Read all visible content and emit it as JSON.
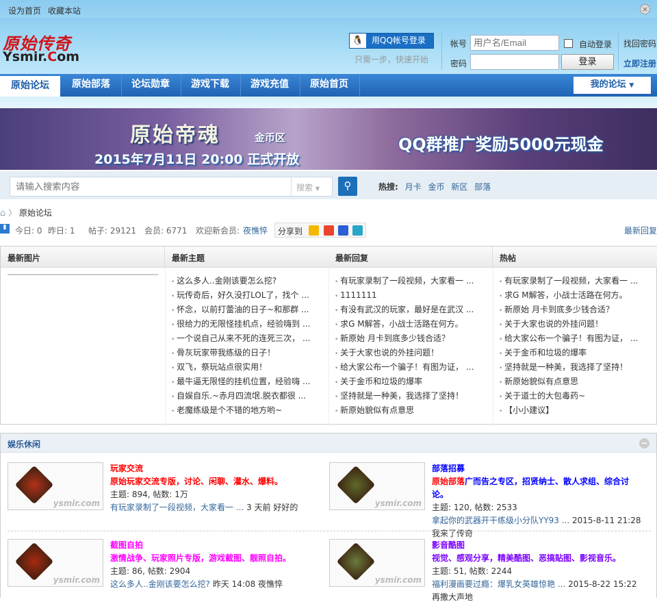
{
  "topbar": {
    "set_home": "设为首页",
    "bookmark": "收藏本站"
  },
  "logo": {
    "cn": "原始传奇",
    "en_a": "Ysmir.",
    "en_b": "C",
    "en_c": "om"
  },
  "login": {
    "qq_button": "用QQ帐号登录",
    "qq_sub": "只需一步，快速开始",
    "account_label": "帐号",
    "account_placeholder": "用户名/Email",
    "password_label": "密码",
    "auto_login": "自动登录",
    "login_button": "登录",
    "find_password": "找回密码",
    "register": "立即注册"
  },
  "nav": {
    "items": [
      "原始论坛",
      "原始部落",
      "论坛勋章",
      "游戏下载",
      "游戏充值",
      "原始首页"
    ],
    "my_forum": "我的论坛"
  },
  "banner": {
    "title": "原始帝魂",
    "zone": "金币区",
    "date": "2015年7月11日 20:00 正式开放",
    "promo": "QQ群推广奖励5000元现金"
  },
  "search": {
    "placeholder": "请输入搜索内容",
    "type": "搜索",
    "hot_label": "热搜:",
    "hot": [
      "月卡",
      "金币",
      "新区",
      "部落"
    ]
  },
  "breadcrumb": {
    "current": "原始论坛"
  },
  "stats": {
    "today": "今日: 0",
    "yesterday": "昨日: 1",
    "posts": "帖子: 29121",
    "members": "会员: 6771",
    "welcome": "欢迎新会员:",
    "new_member": "夜憔悴",
    "share": "分享到",
    "latest_reply": "最新回复"
  },
  "table": {
    "headers": [
      "最新图片",
      "最新主题",
      "最新回复",
      "热帖"
    ],
    "new_topics": [
      "这么多人..金刚该要怎么挖?",
      "玩传奇后，好久没打LOL了，找个 ...",
      "怀念，以前打蕾油的日子~和那群 ...",
      "很给力的无限怪挂机点，经验嗨到 ...",
      "一个说自己从来不死的连死三次， ...",
      "骨灰玩家带我练级的日子！",
      "双飞，祭玩站点很实用！",
      "最牛逼无限怪的挂机位置，经验嗨 ...",
      "自娱自乐.~赤月四流氓.脱衣都很 ...",
      "老魔练级是个不错的地方哟~"
    ],
    "new_replies": [
      "有玩家录制了一段视频，大家看一 ...",
      "1111111",
      "有没有武汉的玩家，最好是在武汉 ...",
      "求G M解答，小战士活路在何方。",
      "新原始 月卡到底多少钱合适？",
      "关于大家也说的外挂问题！",
      "给大家公布一个骗子！有图为证， ...",
      "关于金币和垃圾的爆率",
      "坚持就是一种美，我选择了坚持！",
      "新原始貌似有点意思"
    ],
    "hot": [
      "有玩家录制了一段视频，大家看一 ...",
      "求G M解答，小战士活路在何方。",
      "新原始 月卡到底多少钱合适？",
      "关于大家也说的外挂问题！",
      "给大家公布一个骗子！有图为证， ...",
      "关于金币和垃圾的爆率",
      "坚持就是一种美，我选择了坚持！",
      "新原始貌似有点意思",
      "关于道士的大包毒药~",
      "【小小建议】"
    ]
  },
  "section": {
    "title": "娱乐休闲",
    "watermark": "ysmir.com",
    "forums": [
      {
        "name": "玩家交流",
        "color": "#ff0000",
        "desc": "原始玩家交流专版，讨论、闲聊、灌水、爆料。",
        "desc_prefix": "",
        "counts": "主题: 894, 帖数: 1万",
        "last_link": "有玩家录制了一段视频，大家看一 ...",
        "last_meta": " 3 天前 好好的"
      },
      {
        "name": "部落招募",
        "color": "#0000ff",
        "desc_prefix": "原始部落",
        "desc": "广而告之专区，招贤纳士、散人求组、综合讨论。",
        "counts": "主题: 120, 帖数: 2533",
        "last_link": "拿起你的武器开干练级小分队YY93 ...",
        "last_meta": " 2015-8-11 21:28 我来了传奇"
      },
      {
        "name": "截图自拍",
        "color": "#ff00ff",
        "desc_prefix": "",
        "desc": "激情战争、玩家照片专版，游戏截图、靓照自拍。",
        "counts": "主题: 86, 帖数: 2904",
        "last_link": "这么多人..金刚该要怎么挖?",
        "last_meta": " 昨天 14:08 夜憔悴"
      },
      {
        "name": "影音酷图",
        "color": "#7b00ff",
        "desc_prefix": "",
        "desc": "视觉、感观分享，精美酷图、恶搞贴图、影视音乐。",
        "counts": "主题: 51, 帖数: 2244",
        "last_link": "福利漫画要过瘾：爆乳女英雄惊艳 ...",
        "last_meta": " 2015-8-22 15:22 再撒大声地"
      }
    ]
  }
}
